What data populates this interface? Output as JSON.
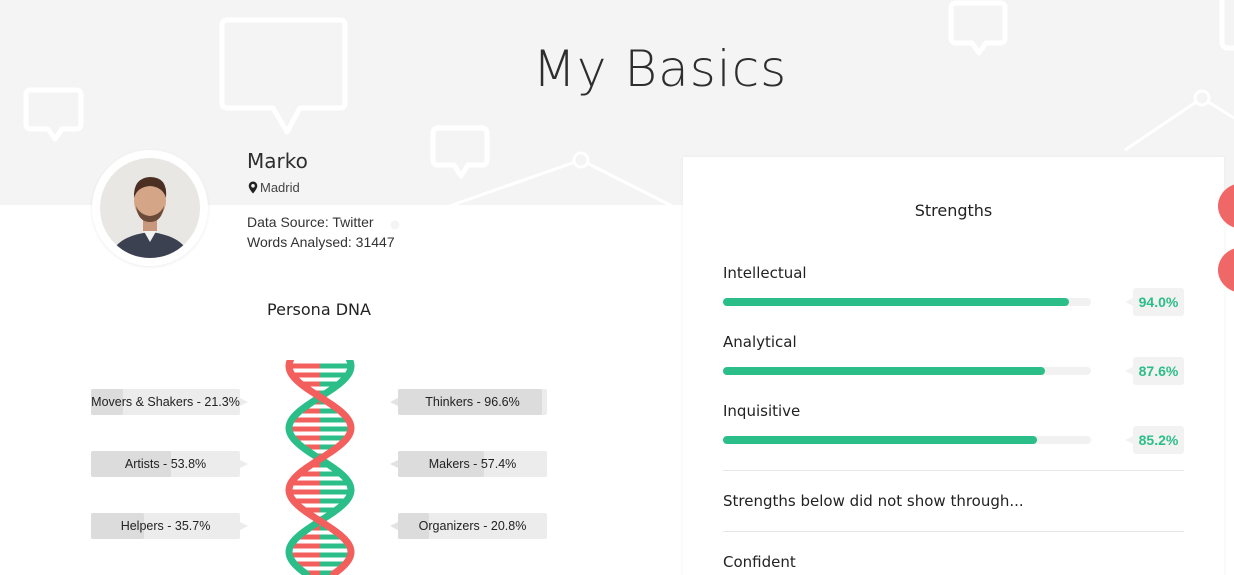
{
  "page": {
    "title": "My Basics"
  },
  "profile": {
    "name": "Marko",
    "location": "Madrid",
    "data_source": "Data Source: Twitter",
    "words_analysed": "Words Analysed: 31447"
  },
  "persona_dna": {
    "title": "Persona DNA",
    "colors": {
      "red": "#f25f5c",
      "green": "#2cbe88"
    },
    "left_tags": [
      {
        "label": "Movers & Shakers - 21.3%",
        "value": 21.3
      },
      {
        "label": "Artists - 53.8%",
        "value": 53.8
      },
      {
        "label": "Helpers - 35.7%",
        "value": 35.7
      }
    ],
    "right_tags": [
      {
        "label": "Thinkers - 96.6%",
        "value": 96.6
      },
      {
        "label": "Makers - 57.4%",
        "value": 57.4
      },
      {
        "label": "Organizers - 20.8%",
        "value": 20.8
      }
    ]
  },
  "strengths": {
    "title": "Strengths",
    "accent": "#2cbe88",
    "items": [
      {
        "label": "Intellectual",
        "percent": "94.0%",
        "value": 94.0
      },
      {
        "label": "Analytical",
        "percent": "87.6%",
        "value": 87.6
      },
      {
        "label": "Inquisitive",
        "percent": "85.2%",
        "value": 85.2
      }
    ],
    "note": "Strengths below did not show through...",
    "hidden_items": [
      {
        "label": "Confident"
      }
    ]
  },
  "floating_buttons": [
    {
      "icon": "action-icon"
    },
    {
      "icon": "action-icon"
    }
  ]
}
